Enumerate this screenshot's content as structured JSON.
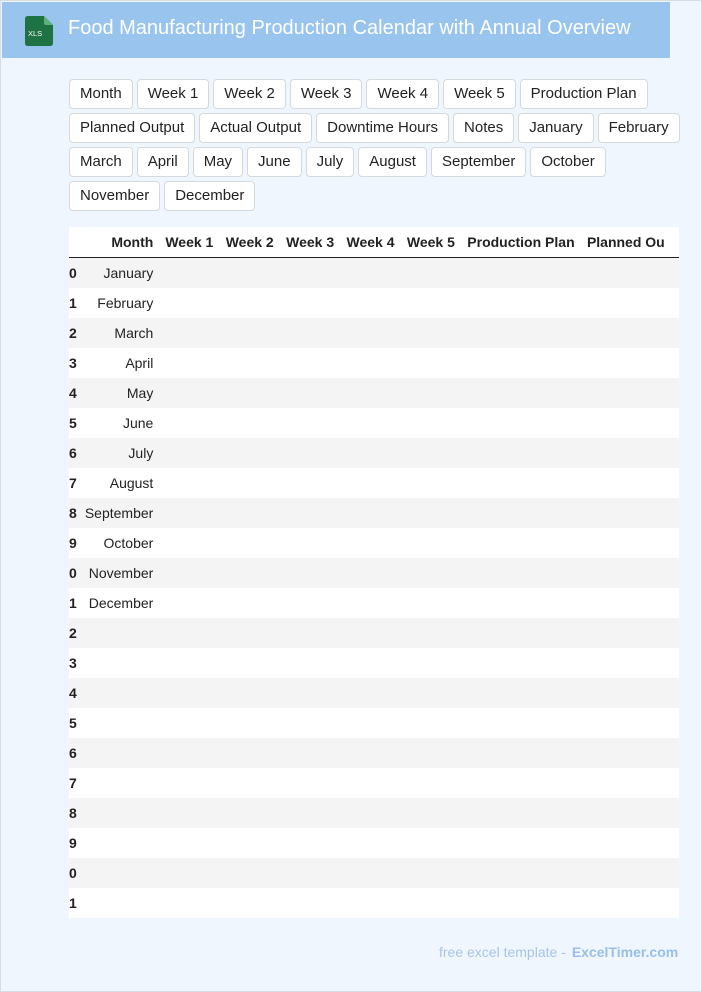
{
  "header": {
    "title": "Food Manufacturing Production Calendar with Annual Overview",
    "icon_label": "XLS"
  },
  "tags": [
    "Month",
    "Week 1",
    "Week 2",
    "Week 3",
    "Week 4",
    "Week 5",
    "Production Plan",
    "Planned Output",
    "Actual Output",
    "Downtime Hours",
    "Notes",
    "January",
    "February",
    "March",
    "April",
    "May",
    "June",
    "July",
    "August",
    "September",
    "October",
    "November",
    "December"
  ],
  "table": {
    "columns": [
      "Month",
      "Week 1",
      "Week 2",
      "Week 3",
      "Week 4",
      "Week 5",
      "Production Plan",
      "Planned Ou"
    ],
    "index": [
      "0",
      "1",
      "2",
      "3",
      "4",
      "5",
      "6",
      "7",
      "8",
      "9",
      "0",
      "1",
      "2",
      "3",
      "4",
      "5",
      "6",
      "7",
      "8",
      "9",
      "0",
      "1"
    ],
    "months": [
      "January",
      "February",
      "March",
      "April",
      "May",
      "June",
      "July",
      "August",
      "September",
      "October",
      "November",
      "December",
      "",
      "",
      "",
      "",
      "",
      "",
      "",
      "",
      "",
      ""
    ]
  },
  "footer": {
    "text": "free excel template -",
    "brand": "ExcelTimer.com"
  },
  "colors": {
    "header": "#98c4ee",
    "background": "#f0f6fe",
    "icon": "#1f7244"
  }
}
